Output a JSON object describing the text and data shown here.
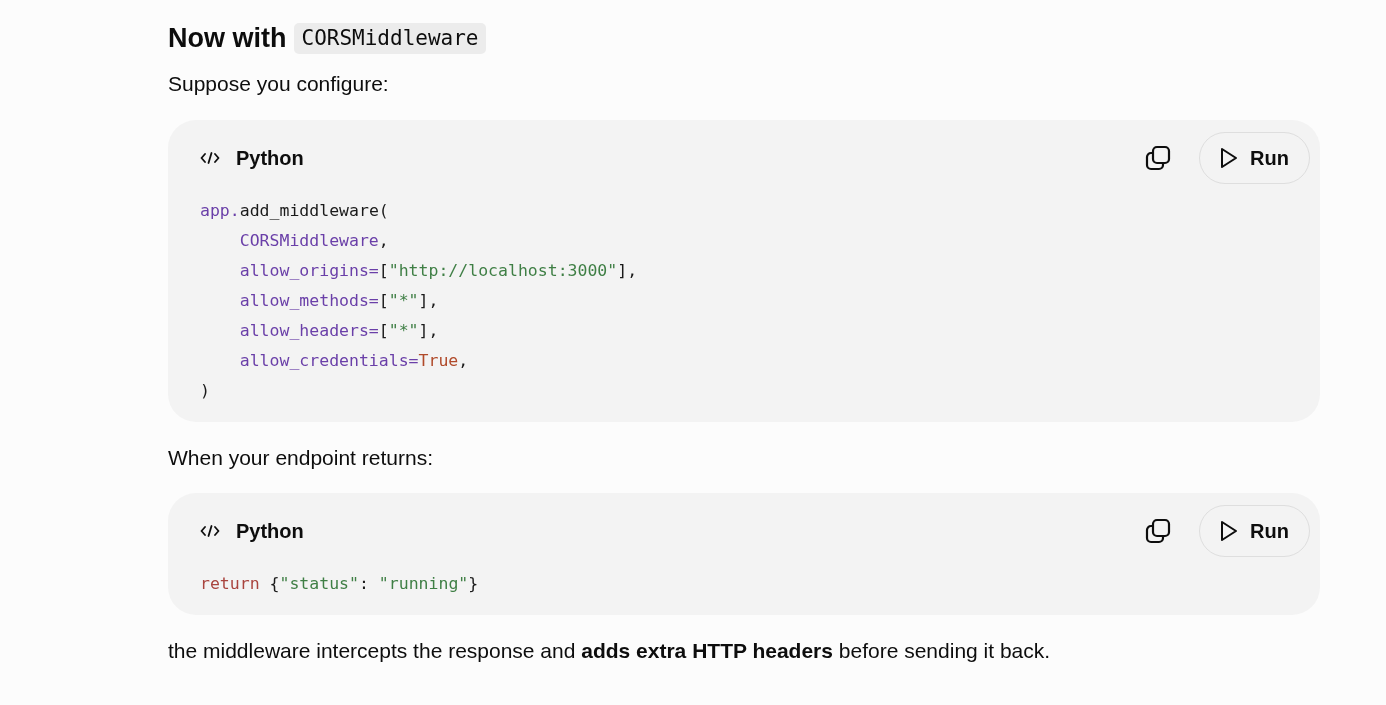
{
  "heading": {
    "text": "Now with",
    "code": "CORSMiddleware"
  },
  "blocks": [
    {
      "kind": "paragraph",
      "text": "Suppose you configure:"
    },
    {
      "kind": "code",
      "language": "Python",
      "run_label": "Run",
      "lines": [
        {
          "indented": false,
          "tokens": [
            {
              "kind": "name",
              "text": "app."
            },
            {
              "kind": "plain",
              "text": "add_middleware("
            }
          ]
        },
        {
          "indented": true,
          "tokens": [
            {
              "kind": "name",
              "text": "CORSMiddleware"
            },
            {
              "kind": "plain",
              "text": ","
            }
          ]
        },
        {
          "indented": true,
          "tokens": [
            {
              "kind": "name",
              "text": "allow_origins="
            },
            {
              "kind": "plain",
              "text": "["
            },
            {
              "kind": "string",
              "text": "\"http://localhost:3000\""
            },
            {
              "kind": "plain",
              "text": "],"
            }
          ]
        },
        {
          "indented": true,
          "tokens": [
            {
              "kind": "name",
              "text": "allow_methods="
            },
            {
              "kind": "plain",
              "text": "["
            },
            {
              "kind": "string",
              "text": "\"*\""
            },
            {
              "kind": "plain",
              "text": "],"
            }
          ]
        },
        {
          "indented": true,
          "tokens": [
            {
              "kind": "name",
              "text": "allow_headers="
            },
            {
              "kind": "plain",
              "text": "["
            },
            {
              "kind": "string",
              "text": "\"*\""
            },
            {
              "kind": "plain",
              "text": "],"
            }
          ]
        },
        {
          "indented": true,
          "tokens": [
            {
              "kind": "name",
              "text": "allow_credentials="
            },
            {
              "kind": "literal",
              "text": "True"
            },
            {
              "kind": "plain",
              "text": ","
            }
          ]
        },
        {
          "indented": false,
          "tokens": [
            {
              "kind": "plain",
              "text": ")"
            }
          ]
        }
      ]
    },
    {
      "kind": "paragraph",
      "text": "When your endpoint returns:"
    },
    {
      "kind": "code",
      "language": "Python",
      "run_label": "Run",
      "lines": [
        {
          "indented": false,
          "tokens": [
            {
              "kind": "keyword",
              "text": "return"
            },
            {
              "kind": "plain",
              "text": " {"
            },
            {
              "kind": "string",
              "text": "\"status\""
            },
            {
              "kind": "plain",
              "text": ": "
            },
            {
              "kind": "string",
              "text": "\"running\""
            },
            {
              "kind": "plain",
              "text": "}"
            }
          ]
        }
      ]
    },
    {
      "kind": "paragraph",
      "text": "the middleware intercepts the response and **adds extra HTTP headers** before sending it back."
    }
  ]
}
